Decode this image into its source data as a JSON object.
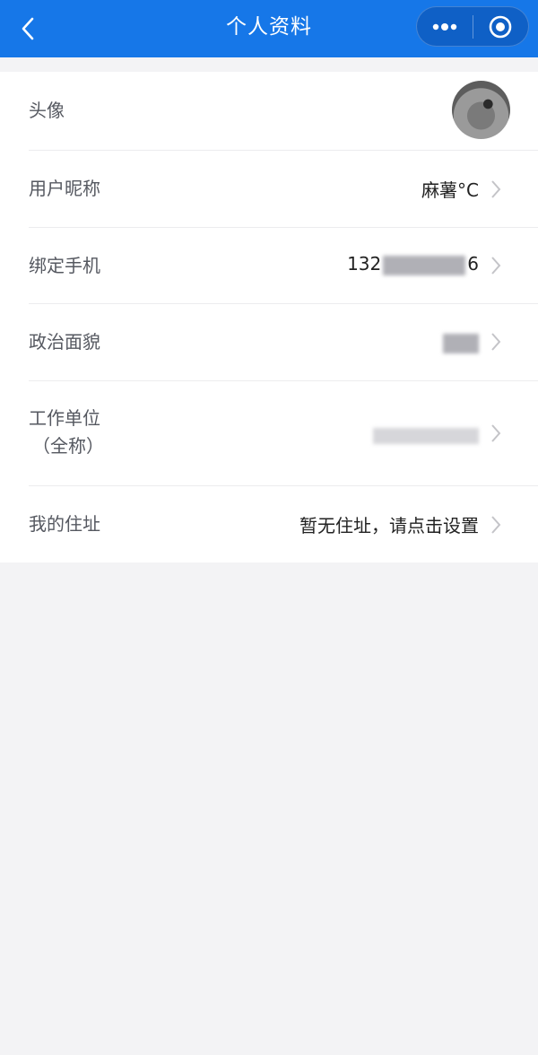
{
  "navbar": {
    "title": "个人资料",
    "back_icon": "chevron-left-icon",
    "more_icon": "more-dots-icon",
    "close_icon": "target-circle-icon",
    "background_color": "#1677e8"
  },
  "profile": {
    "rows": [
      {
        "label": "头像",
        "value": "",
        "type": "avatar"
      },
      {
        "label": "用户昵称",
        "value": "麻薯°C"
      },
      {
        "label": "绑定手机",
        "value_prefix": "132",
        "value_suffix": "6"
      },
      {
        "label": "政治面貌",
        "value": ""
      },
      {
        "label": "工作单位",
        "label_line2": "（全称）",
        "value": ""
      },
      {
        "label": "我的住址",
        "value": "暂无住址，请点击设置"
      }
    ]
  }
}
